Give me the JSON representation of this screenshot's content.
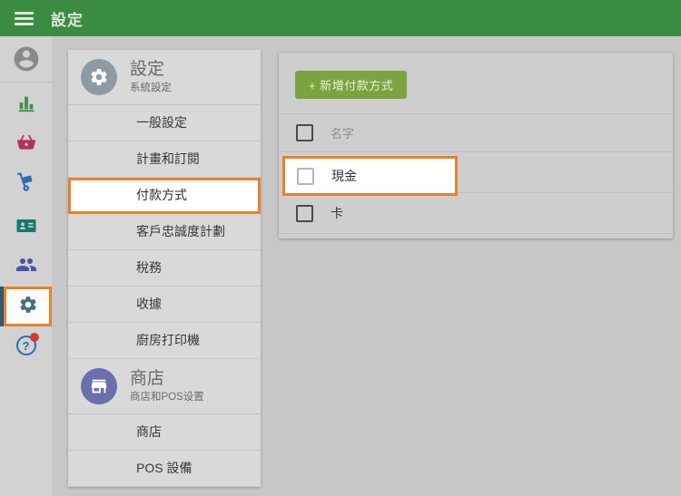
{
  "colors": {
    "topbar_green": "#398c40",
    "button_green": "#7ba441",
    "highlight_orange": "#e8812b",
    "active_strip": "#2e5a70"
  },
  "topbar": {
    "title": "設定"
  },
  "sidebar": {
    "items": [
      {
        "name": "profile",
        "icon": "avatar-icon",
        "color": "#8a8a8a"
      },
      {
        "name": "reports",
        "icon": "bar-chart-icon",
        "color": "#3f8f43"
      },
      {
        "name": "items",
        "icon": "basket-icon",
        "color": "#b5305e"
      },
      {
        "name": "inventory",
        "icon": "hand-truck-icon",
        "color": "#2a6cb0"
      },
      {
        "name": "customers",
        "icon": "contact-card-icon",
        "color": "#14796b"
      },
      {
        "name": "employees",
        "icon": "people-icon",
        "color": "#4a53a8"
      },
      {
        "name": "settings",
        "icon": "gear-icon",
        "color": "#4a6b80",
        "active": true,
        "highlighted": true
      },
      {
        "name": "help",
        "icon": "help-icon",
        "color": "#2a6db5",
        "badge": true,
        "question_mark": "?"
      }
    ]
  },
  "settings_menu": {
    "sections": [
      {
        "title": "設定",
        "subtitle": "系統設定",
        "icon": "gear-icon",
        "items": [
          "一般設定",
          "計畫和訂閱",
          "付款方式",
          "客戶忠誠度計劃",
          "稅務",
          "收據",
          "廚房打印機"
        ],
        "highlighted_item": "付款方式"
      },
      {
        "title": "商店",
        "subtitle": "商店和POS设置",
        "icon": "store-icon",
        "items": [
          "商店",
          "POS 設備"
        ]
      }
    ]
  },
  "main": {
    "add_button": "+ 新增付款方式",
    "table": {
      "header": "名字",
      "rows": [
        "現金",
        "卡"
      ],
      "highlighted_row": "現金"
    }
  }
}
